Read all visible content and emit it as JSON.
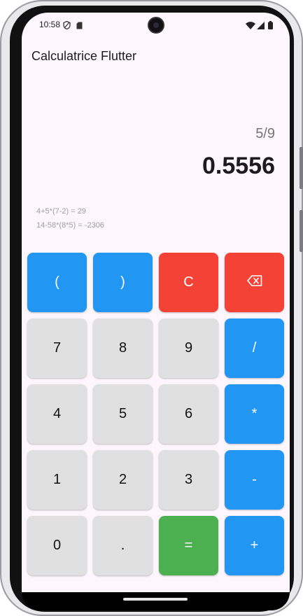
{
  "status_bar": {
    "time": "10:58"
  },
  "app": {
    "title": "Calculatrice Flutter"
  },
  "display": {
    "expression": "5/9",
    "result": "0.5556"
  },
  "history": [
    "4+5*(7-2) = 29",
    "14-58*(8*5) = -2306"
  ],
  "keypad": {
    "open_paren": "(",
    "close_paren": ")",
    "clear": "C",
    "seven": "7",
    "eight": "8",
    "nine": "9",
    "divide": "/",
    "four": "4",
    "five": "5",
    "six": "6",
    "multiply": "*",
    "one": "1",
    "two": "2",
    "three": "3",
    "minus": "-",
    "zero": "0",
    "decimal": ".",
    "equals": "=",
    "plus": "+"
  },
  "colors": {
    "operator_blue": "#2196f3",
    "clear_red": "#f44336",
    "equals_green": "#4caf50",
    "digit_grey": "#e0e0e0",
    "background": "#fdf7fd"
  },
  "icons": {
    "backspace": "backspace-icon",
    "wifi": "wifi-icon",
    "signal": "signal-icon",
    "battery": "battery-icon"
  }
}
